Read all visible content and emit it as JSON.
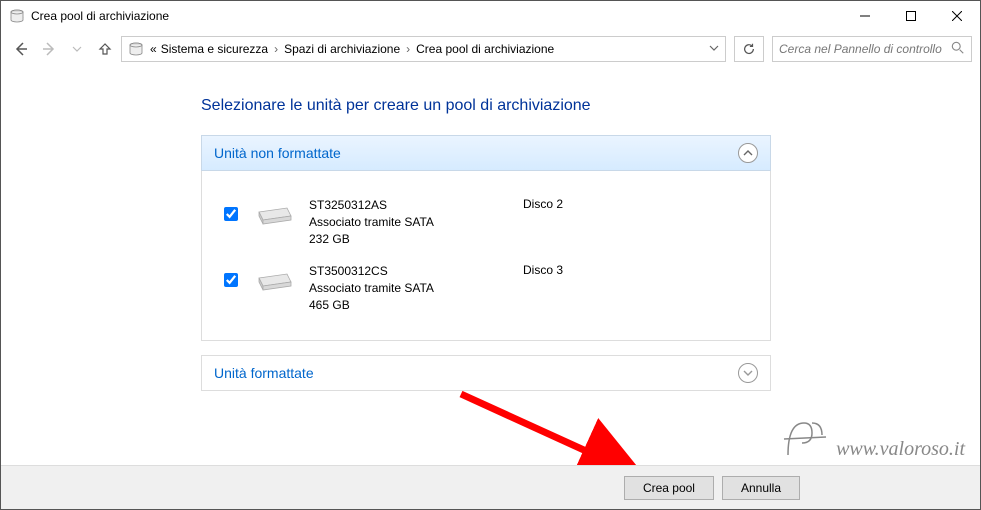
{
  "window": {
    "title": "Crea pool di archiviazione"
  },
  "breadcrumb": {
    "prefix": "«",
    "item1": "Sistema e sicurezza",
    "item2": "Spazi di archiviazione",
    "item3": "Crea pool di archiviazione"
  },
  "search": {
    "placeholder": "Cerca nel Pannello di controllo"
  },
  "heading": "Selezionare le unità per creare un pool di archiviazione",
  "section1": {
    "title": "Unità non formattate",
    "drives": [
      {
        "model": "ST3250312AS",
        "connection": "Associato tramite SATA",
        "size": "232 GB",
        "label": "Disco 2"
      },
      {
        "model": "ST3500312CS",
        "connection": "Associato tramite SATA",
        "size": "465 GB",
        "label": "Disco 3"
      }
    ]
  },
  "section2": {
    "title": "Unità formattate"
  },
  "footer": {
    "create": "Crea pool",
    "cancel": "Annulla"
  },
  "watermark": {
    "text": "www.valoroso.it"
  }
}
